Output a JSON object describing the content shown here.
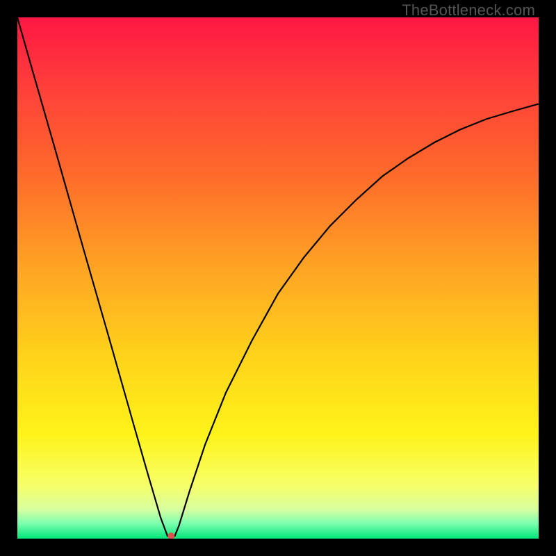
{
  "watermark": "TheBottleneck.com",
  "chart_data": {
    "type": "line",
    "title": "",
    "xlabel": "",
    "ylabel": "",
    "xlim": [
      0,
      100
    ],
    "ylim": [
      0,
      100
    ],
    "grid": false,
    "legend": false,
    "background_gradient_stops": [
      {
        "offset": 0.0,
        "color": "#ff1744"
      },
      {
        "offset": 0.12,
        "color": "#ff3b3b"
      },
      {
        "offset": 0.3,
        "color": "#ff6a2b"
      },
      {
        "offset": 0.48,
        "color": "#ffa424"
      },
      {
        "offset": 0.65,
        "color": "#ffd31a"
      },
      {
        "offset": 0.8,
        "color": "#fff31a"
      },
      {
        "offset": 0.9,
        "color": "#f6ff6a"
      },
      {
        "offset": 0.945,
        "color": "#d6ffa0"
      },
      {
        "offset": 0.97,
        "color": "#7fffb0"
      },
      {
        "offset": 1.0,
        "color": "#00e57a"
      }
    ],
    "series": [
      {
        "name": "bottleneck-curve",
        "x": [
          0,
          2.5,
          5,
          7.5,
          10,
          12.5,
          15,
          17.5,
          20,
          22.5,
          25,
          27.5,
          28.8,
          29.5,
          30.2,
          31.0,
          33,
          36,
          40,
          45,
          50,
          55,
          60,
          65,
          70,
          75,
          80,
          85,
          90,
          95,
          100
        ],
        "y": [
          100,
          91.2,
          82.5,
          73.8,
          65,
          56.2,
          47.5,
          38.8,
          30,
          21.2,
          12.5,
          4.0,
          0.5,
          0.5,
          0.5,
          2.5,
          9,
          18,
          28,
          38,
          47,
          54,
          60,
          65,
          69.5,
          73,
          76,
          78.5,
          80.5,
          82,
          83.4
        ]
      }
    ],
    "marker": {
      "x": 29.5,
      "y": 0.5,
      "color": "#d9534f",
      "radius_px": 5
    },
    "annotations": []
  }
}
